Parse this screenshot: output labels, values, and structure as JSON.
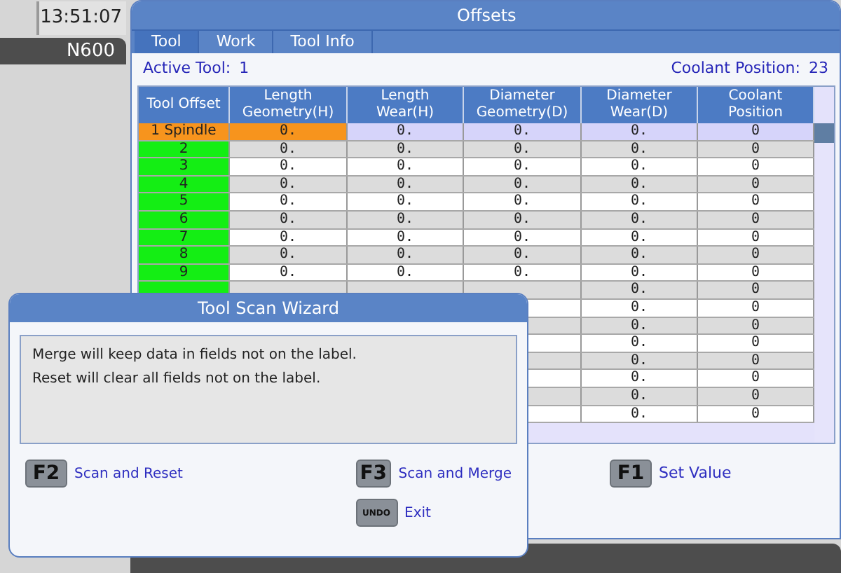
{
  "clock": "13:51:07",
  "program": "N600",
  "panel": {
    "title": "Offsets",
    "tabs": [
      {
        "label": "Tool",
        "selected": true
      },
      {
        "label": "Work",
        "selected": false
      },
      {
        "label": "Tool Info",
        "selected": false
      }
    ],
    "active_tool": {
      "label": "Active Tool:",
      "value": "1"
    },
    "coolant_position": {
      "label": "Coolant Position:",
      "value": "23"
    },
    "table": {
      "columns": [
        "Tool Offset",
        "Length Geometry(H)",
        "Length Wear(H)",
        "Diameter Geometry(D)",
        "Diameter Wear(D)",
        "Coolant Position"
      ],
      "rows": [
        {
          "tool": "1 Spindle",
          "length_geometry": "0.",
          "length_wear": "0.",
          "diameter_geometry": "0.",
          "diameter_wear": "0.",
          "coolant": "0",
          "selected": true
        },
        {
          "tool": "2",
          "length_geometry": "0.",
          "length_wear": "0.",
          "diameter_geometry": "0.",
          "diameter_wear": "0.",
          "coolant": "0",
          "selected": false
        },
        {
          "tool": "3",
          "length_geometry": "0.",
          "length_wear": "0.",
          "diameter_geometry": "0.",
          "diameter_wear": "0.",
          "coolant": "0",
          "selected": false
        },
        {
          "tool": "4",
          "length_geometry": "0.",
          "length_wear": "0.",
          "diameter_geometry": "0.",
          "diameter_wear": "0.",
          "coolant": "0",
          "selected": false
        },
        {
          "tool": "5",
          "length_geometry": "0.",
          "length_wear": "0.",
          "diameter_geometry": "0.",
          "diameter_wear": "0.",
          "coolant": "0",
          "selected": false
        },
        {
          "tool": "6",
          "length_geometry": "0.",
          "length_wear": "0.",
          "diameter_geometry": "0.",
          "diameter_wear": "0.",
          "coolant": "0",
          "selected": false
        },
        {
          "tool": "7",
          "length_geometry": "0.",
          "length_wear": "0.",
          "diameter_geometry": "0.",
          "diameter_wear": "0.",
          "coolant": "0",
          "selected": false
        },
        {
          "tool": "8",
          "length_geometry": "0.",
          "length_wear": "0.",
          "diameter_geometry": "0.",
          "diameter_wear": "0.",
          "coolant": "0",
          "selected": false
        },
        {
          "tool": "9",
          "length_geometry": "0.",
          "length_wear": "0.",
          "diameter_geometry": "0.",
          "diameter_wear": "0.",
          "coolant": "0",
          "selected": false
        },
        {
          "diameter_wear": "0.",
          "coolant": "0",
          "selected": false
        },
        {
          "diameter_wear": "0.",
          "coolant": "0",
          "selected": false
        },
        {
          "diameter_wear": "0.",
          "coolant": "0",
          "selected": false
        },
        {
          "diameter_wear": "0.",
          "coolant": "0",
          "selected": false
        },
        {
          "diameter_wear": "0.",
          "coolant": "0",
          "selected": false
        },
        {
          "diameter_wear": "0.",
          "coolant": "0",
          "selected": false
        },
        {
          "diameter_wear": "0.",
          "coolant": "0",
          "selected": false
        },
        {
          "diameter_wear": "0.",
          "coolant": "0",
          "selected": false
        }
      ]
    },
    "keys": [
      {
        "key": "F1",
        "label": "Set Value"
      }
    ]
  },
  "dialog": {
    "title": "Tool Scan Wizard",
    "message": [
      "Merge will keep data in fields not on the label.",
      "Reset will clear all fields not on the label."
    ],
    "keys": [
      {
        "key": "F2",
        "label": "Scan and Reset",
        "kind": "fkey"
      },
      {
        "key": "F3",
        "label": "Scan and Merge",
        "kind": "fkey"
      },
      {
        "key": "UNDO",
        "label": "Exit",
        "kind": "small"
      }
    ]
  }
}
